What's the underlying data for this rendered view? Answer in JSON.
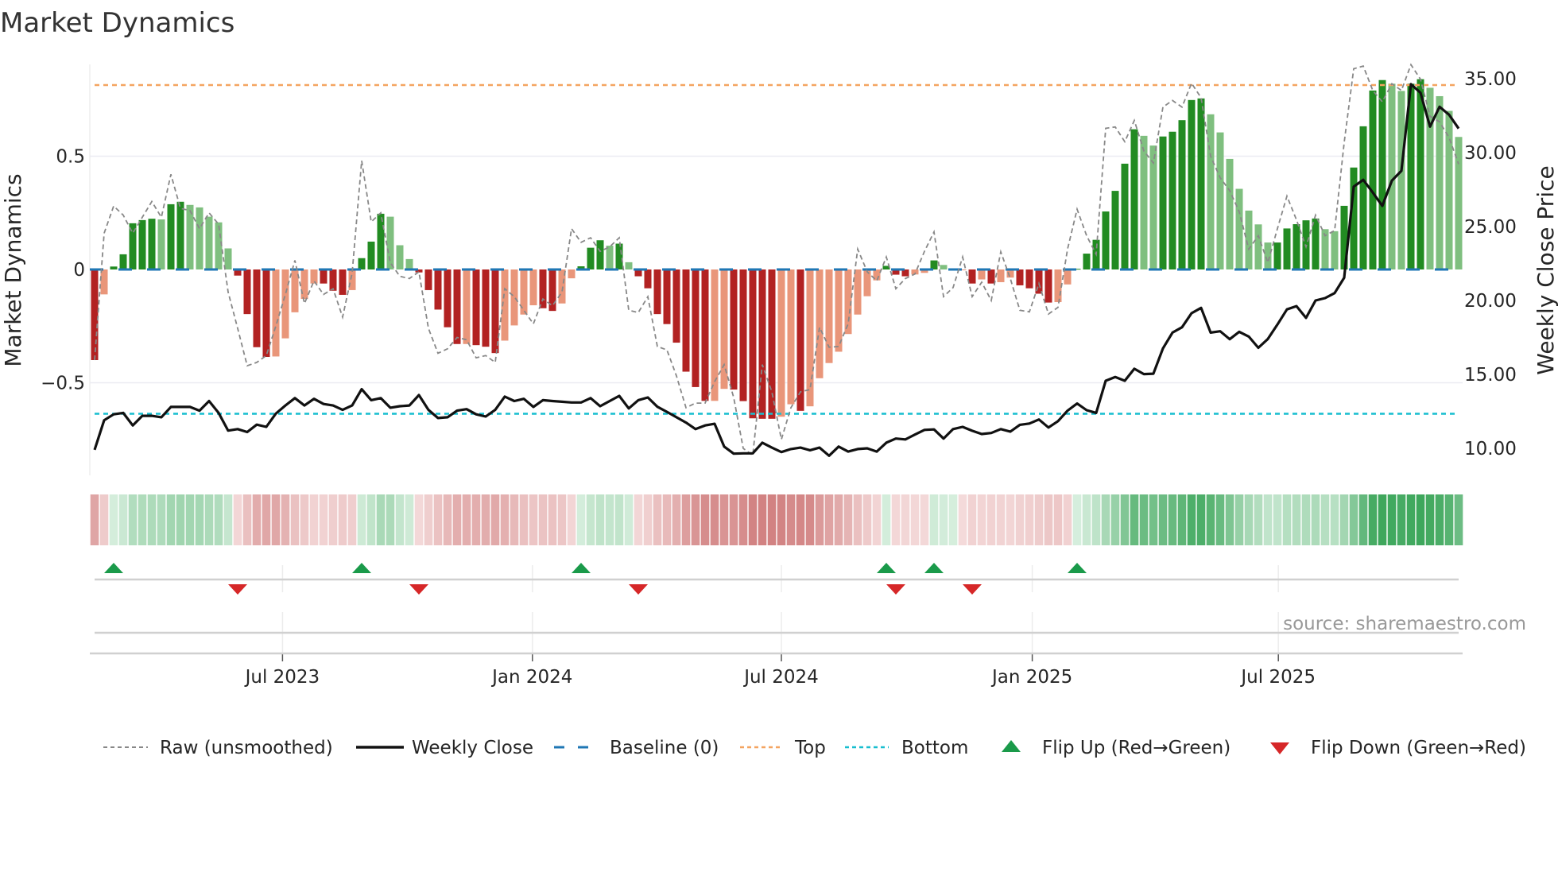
{
  "title": "Market Dynamics",
  "source": "source: sharemaestro.com",
  "colors": {
    "up_strong": "#228b22",
    "up_weak": "#7fbf7f",
    "down_strong": "#b22222",
    "down_weak": "#e9967a",
    "raw": "#888888",
    "close": "#111111",
    "baseline": "#1f77b4",
    "top": "#f4a460",
    "bottom": "#17becf",
    "flip_up": "#1a9a4a",
    "flip_down": "#d62728"
  },
  "legend": {
    "raw": "Raw (unsmoothed)",
    "close": "Weekly Close",
    "baseline": "Baseline (0)",
    "top": "Top",
    "bottom": "Bottom",
    "flip_up": "Flip Up (Red→Green)",
    "flip_down": "Flip Down (Green→Red)"
  },
  "chart_data": {
    "type": "bar",
    "title": "Market Dynamics",
    "ylabel": "Market Dynamics",
    "y2label": "Weekly Close Price",
    "ylim": [
      -0.91,
      0.905
    ],
    "y2lim": [
      8.17,
      35.97
    ],
    "yticks": [
      "0.5",
      "0",
      "−0.5"
    ],
    "ytick_values": [
      0.5,
      0,
      -0.5
    ],
    "y2ticks": [
      "35.00",
      "30.00",
      "25.00",
      "20.00",
      "15.00",
      "10.00"
    ],
    "y2tick_values": [
      35,
      30,
      25,
      20,
      15,
      10
    ],
    "xticks": [
      "Jul 2023",
      "Jan 2024",
      "Jul 2024",
      "Jan 2025",
      "Jul 2025"
    ],
    "xtick_week_index": [
      19.7,
      45.9,
      72,
      98.3,
      124.1
    ],
    "top_level": 0.814,
    "bottom_level": -0.637,
    "baseline": 0,
    "momentum": [
      -0.4,
      -0.11,
      0.013,
      0.067,
      0.204,
      0.218,
      0.224,
      0.221,
      0.288,
      0.299,
      0.285,
      0.274,
      0.233,
      0.208,
      0.093,
      -0.027,
      -0.197,
      -0.343,
      -0.386,
      -0.384,
      -0.304,
      -0.189,
      -0.13,
      -0.062,
      -0.062,
      -0.094,
      -0.112,
      -0.091,
      0.05,
      0.123,
      0.246,
      0.233,
      0.107,
      0.046,
      -0.013,
      -0.091,
      -0.177,
      -0.255,
      -0.329,
      -0.329,
      -0.334,
      -0.341,
      -0.369,
      -0.314,
      -0.247,
      -0.199,
      -0.158,
      -0.171,
      -0.183,
      -0.15,
      -0.039,
      0.014,
      0.096,
      0.129,
      0.105,
      0.114,
      0.032,
      -0.03,
      -0.083,
      -0.197,
      -0.241,
      -0.323,
      -0.451,
      -0.519,
      -0.58,
      -0.58,
      -0.527,
      -0.53,
      -0.581,
      -0.657,
      -0.659,
      -0.659,
      -0.65,
      -0.595,
      -0.624,
      -0.604,
      -0.48,
      -0.413,
      -0.363,
      -0.285,
      -0.199,
      -0.118,
      -0.048,
      0.016,
      -0.023,
      -0.03,
      -0.022,
      -0.015,
      0.04,
      0.02,
      0.005,
      -0.002,
      -0.062,
      -0.044,
      -0.062,
      -0.056,
      -0.036,
      -0.07,
      -0.083,
      -0.107,
      -0.146,
      -0.144,
      -0.066,
      0.003,
      0.07,
      0.131,
      0.256,
      0.347,
      0.467,
      0.619,
      0.59,
      0.547,
      0.587,
      0.608,
      0.659,
      0.748,
      0.755,
      0.685,
      0.605,
      0.488,
      0.356,
      0.26,
      0.199,
      0.119,
      0.119,
      0.181,
      0.2,
      0.217,
      0.225,
      0.178,
      0.169,
      0.281,
      0.45,
      0.632,
      0.79,
      0.836,
      0.82,
      0.788,
      0.82,
      0.84,
      0.802,
      0.765,
      0.7,
      0.585
    ],
    "shade": "DLDDDDDLDDLLLLLDDDDLLLLLDDDLDDDLLLDDDDDLDDDLLLLDDLLDDDLDLDDDDDDDDLLDDDDDLLDLLLLLLLLDDDLLDLLLDLDLLDDDDLLDDDDDDDLLDDDDDLLLLLLLDDDDDLLDDDDDLLDDLLLL",
    "raw": [
      -0.4,
      0.16,
      0.28,
      0.24,
      0.16,
      0.23,
      0.3,
      0.23,
      0.42,
      0.27,
      0.26,
      0.18,
      0.25,
      0.2,
      -0.1,
      -0.26,
      -0.425,
      -0.41,
      -0.38,
      -0.25,
      -0.11,
      0.04,
      -0.15,
      -0.05,
      -0.11,
      -0.085,
      -0.21,
      -0.015,
      0.48,
      0.21,
      0.25,
      0.03,
      -0.03,
      -0.04,
      -0.01,
      -0.26,
      -0.37,
      -0.35,
      -0.3,
      -0.31,
      -0.39,
      -0.38,
      -0.41,
      -0.085,
      -0.12,
      -0.18,
      -0.24,
      -0.13,
      -0.16,
      -0.1,
      0.18,
      0.12,
      0.14,
      0.08,
      0.1,
      0.14,
      -0.18,
      -0.19,
      -0.12,
      -0.34,
      -0.355,
      -0.47,
      -0.61,
      -0.59,
      -0.59,
      -0.495,
      -0.42,
      -0.565,
      -0.79,
      -0.82,
      -0.42,
      -0.54,
      -0.75,
      -0.61,
      -0.54,
      -0.53,
      -0.255,
      -0.343,
      -0.34,
      -0.24,
      0.09,
      -0.01,
      -0.05,
      0.055,
      -0.085,
      -0.04,
      -0.02,
      0.08,
      0.166,
      -0.12,
      -0.08,
      0.055,
      -0.12,
      -0.056,
      -0.137,
      0.078,
      -0.04,
      -0.18,
      -0.187,
      -0.062,
      -0.197,
      -0.167,
      0.09,
      0.266,
      0.149,
      0.067,
      0.623,
      0.629,
      0.564,
      0.658,
      0.523,
      0.47,
      0.717,
      0.746,
      0.717,
      0.822,
      0.758,
      0.5,
      0.405,
      0.348,
      0.254,
      0.09,
      0.149,
      0.03,
      0.18,
      0.324,
      0.219,
      0.1,
      0.24,
      0.149,
      0.172,
      0.56,
      0.886,
      0.898,
      0.79,
      0.74,
      0.82,
      0.79,
      0.904,
      0.84,
      0.676,
      0.652,
      0.582,
      0.465
    ],
    "close": [
      9.9,
      11.9,
      12.3,
      12.4,
      11.55,
      12.2,
      12.2,
      12.1,
      12.8,
      12.8,
      12.8,
      12.55,
      13.2,
      12.4,
      11.2,
      11.3,
      11.1,
      11.6,
      11.45,
      12.35,
      12.9,
      13.4,
      12.9,
      13.35,
      13.0,
      12.9,
      12.6,
      12.9,
      14.0,
      13.26,
      13.4,
      12.75,
      12.85,
      12.9,
      13.6,
      12.6,
      12.05,
      12.1,
      12.55,
      12.65,
      12.3,
      12.15,
      12.6,
      13.5,
      13.2,
      13.35,
      12.8,
      13.26,
      13.2,
      13.15,
      13.1,
      13.1,
      13.4,
      12.85,
      13.2,
      13.55,
      12.7,
      13.26,
      13.44,
      12.81,
      12.47,
      12.1,
      11.74,
      11.3,
      11.55,
      11.66,
      10.12,
      9.64,
      9.66,
      9.66,
      10.38,
      10.05,
      9.75,
      9.95,
      10.05,
      9.87,
      10.05,
      9.5,
      10.12,
      9.78,
      9.95,
      10.0,
      9.78,
      10.38,
      10.66,
      10.6,
      10.93,
      11.25,
      11.28,
      10.66,
      11.3,
      11.45,
      11.19,
      10.97,
      11.04,
      11.3,
      11.13,
      11.59,
      11.68,
      11.95,
      11.41,
      11.84,
      12.55,
      13.03,
      12.58,
      12.4,
      14.57,
      14.82,
      14.57,
      15.38,
      15.02,
      15.05,
      16.76,
      17.83,
      18.19,
      19.14,
      19.5,
      17.83,
      17.92,
      17.38,
      17.88,
      17.56,
      16.8,
      17.4,
      18.37,
      19.4,
      19.62,
      18.82,
      20.0,
      20.16,
      20.5,
      21.54,
      27.7,
      28.16,
      27.3,
      26.4,
      28.1,
      28.77,
      34.63,
      34.05,
      31.76,
      33.1,
      32.56,
      31.63
    ],
    "flip_up_week_index": [
      2,
      28,
      51,
      83,
      88,
      103
    ],
    "flip_down_week_index": [
      15,
      34,
      57,
      84,
      92
    ]
  }
}
